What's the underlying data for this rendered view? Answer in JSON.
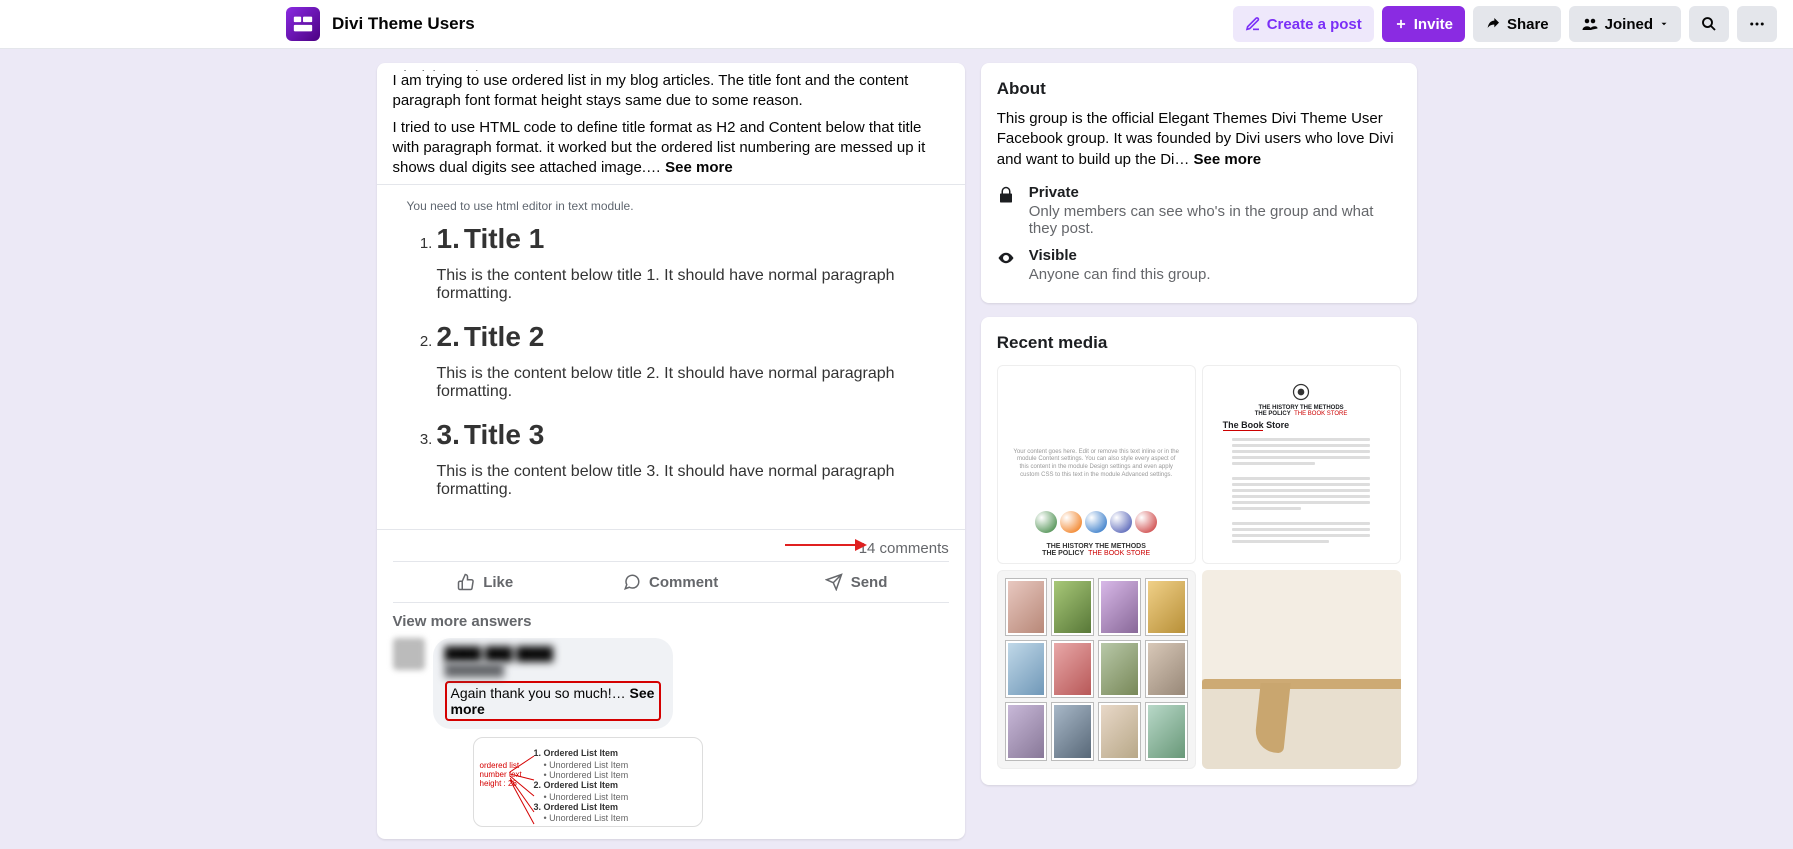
{
  "header": {
    "group_name": "Divi Theme Users",
    "create_post": "Create a post",
    "invite": "Invite",
    "share": "Share",
    "joined": "Joined"
  },
  "post": {
    "truncated_line": "Hi Divi People,",
    "p1": "   I am trying to use ordered list in my blog articles. The title font and the content paragraph font format height stays same due to some reason.",
    "p2": "   I tried to use HTML code to define title format as H2 and Content below that title with paragraph format. it worked but the ordered list numbering are messed up it shows dual digits see attached image.…",
    "see_more": "See more",
    "attach_hint": "You need to use html editor in text module.",
    "items": [
      {
        "num": "1.",
        "title": "Title 1",
        "content": "This is the content below title 1. It should have normal paragraph formatting."
      },
      {
        "num": "2.",
        "title": "Title 2",
        "content": "This is the content below title 2. It should have normal paragraph formatting."
      },
      {
        "num": "3.",
        "title": "Title 3",
        "content": "This is the content below title 3. It should have normal paragraph formatting."
      }
    ],
    "comments_count": "14 comments",
    "actions": {
      "like": "Like",
      "comment": "Comment",
      "send": "Send"
    },
    "view_more": "View more answers",
    "comment": {
      "name": "████ ███ ████",
      "sub": "███████",
      "text": "Again thank you so much!…",
      "see_more": "See more",
      "img_label": "ordered list number text height : 26",
      "img_lines": [
        {
          "t": "ol",
          "text": "1. Ordered List Item"
        },
        {
          "t": "ul",
          "text": "• Unordered List Item"
        },
        {
          "t": "ul",
          "text": "• Unordered List Item"
        },
        {
          "t": "ol",
          "text": "2. Ordered List Item"
        },
        {
          "t": "ul",
          "text": "• Unordered List Item"
        },
        {
          "t": "ol",
          "text": "3. Ordered List Item"
        },
        {
          "t": "ul",
          "text": "• Unordered List Item"
        }
      ]
    }
  },
  "sidebar": {
    "about": {
      "heading": "About",
      "text": "This group is the official Elegant Themes Divi Theme User Facebook group. It was founded by Divi users who love Divi and want to build up the Di…",
      "see_more": "See more",
      "private_title": "Private",
      "private_sub": "Only members can see who's in the group and what they post.",
      "visible_title": "Visible",
      "visible_sub": "Anyone can find this group."
    },
    "media": {
      "heading": "Recent media",
      "item1": {
        "footer_a": "THE HISTORY   THE METHODS",
        "footer_b": "THE POLICY",
        "footer_c": "THE BOOK STORE"
      },
      "item2": {
        "title_a": "THE HISTORY   THE METHODS",
        "title_b": "THE POLICY",
        "title_c": "THE BOOK STORE",
        "book": "The Book Store"
      }
    }
  }
}
